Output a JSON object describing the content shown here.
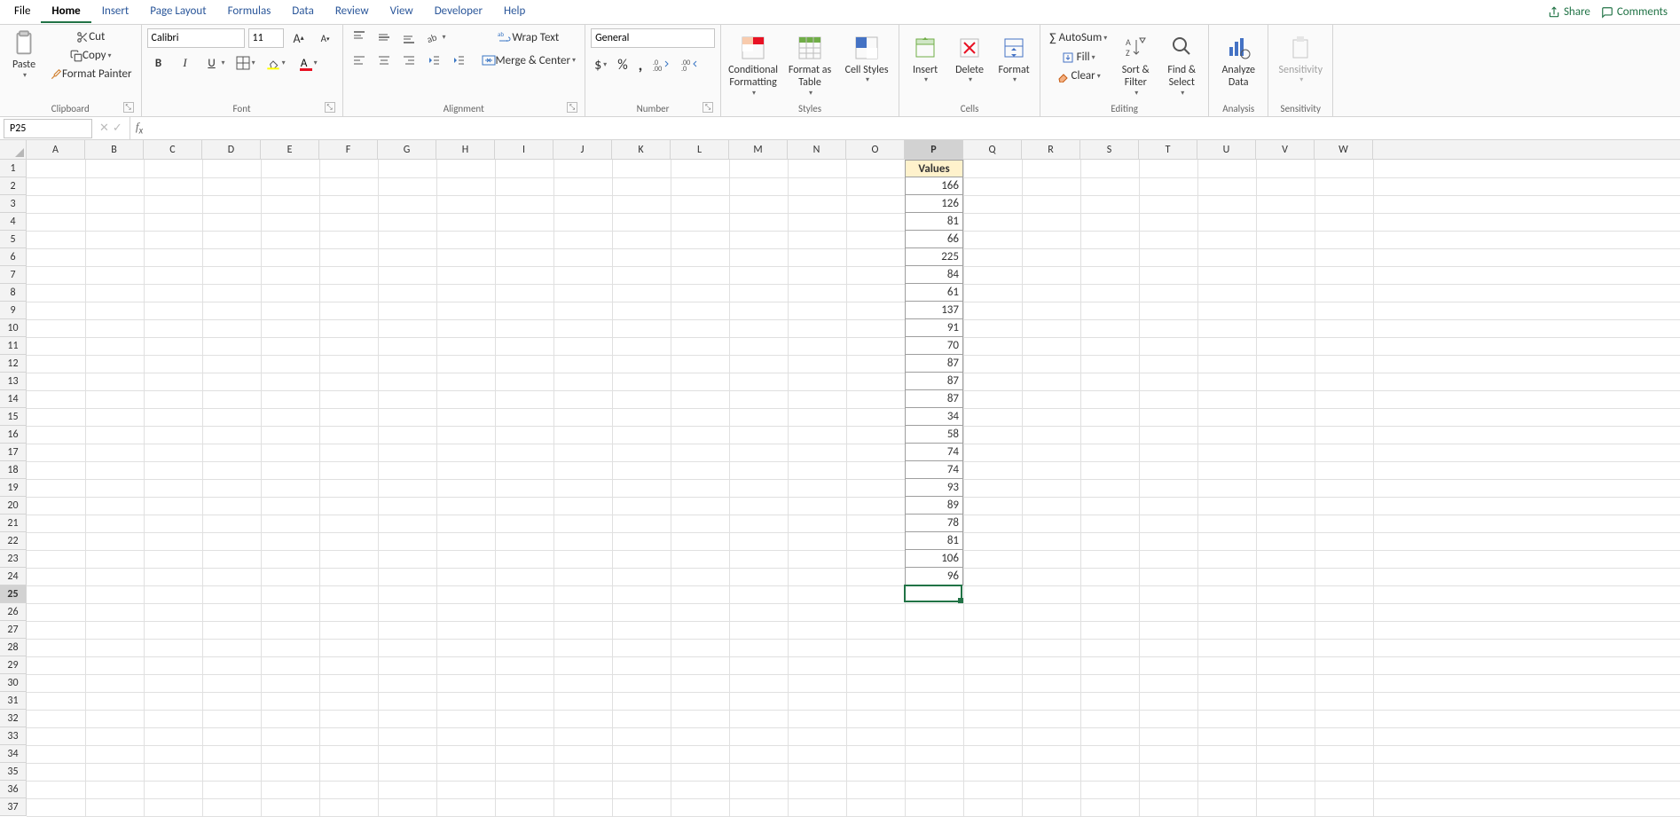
{
  "tabs": {
    "file": "File",
    "home": "Home",
    "insert": "Insert",
    "page_layout": "Page Layout",
    "formulas": "Formulas",
    "data": "Data",
    "review": "Review",
    "view": "View",
    "developer": "Developer",
    "help": "Help"
  },
  "right_actions": {
    "share": "Share",
    "comments": "Comments"
  },
  "ribbon": {
    "clipboard": {
      "paste": "Paste",
      "cut": "Cut",
      "copy": "Copy",
      "format_painter": "Format Painter",
      "label": "Clipboard"
    },
    "font": {
      "name": "Calibri",
      "size": "11",
      "label": "Font"
    },
    "alignment": {
      "wrap": "Wrap Text",
      "merge": "Merge & Center",
      "label": "Alignment"
    },
    "number": {
      "format": "General",
      "label": "Number"
    },
    "styles": {
      "cond": "Conditional Formatting",
      "fat": "Format as Table",
      "cell": "Cell Styles",
      "label": "Styles"
    },
    "cells": {
      "insert": "Insert",
      "delete": "Delete",
      "format": "Format",
      "label": "Cells"
    },
    "editing": {
      "autosum": "AutoSum",
      "fill": "Fill",
      "clear": "Clear",
      "sort": "Sort & Filter",
      "find": "Find & Select",
      "label": "Editing"
    },
    "analysis": {
      "analyze": "Analyze Data",
      "label": "Analysis"
    },
    "sensitivity": {
      "btn": "Sensitivity",
      "label": "Sensitivity"
    }
  },
  "namebox": "P25",
  "formula": "",
  "columns": [
    "A",
    "B",
    "C",
    "D",
    "E",
    "F",
    "G",
    "H",
    "I",
    "J",
    "K",
    "L",
    "M",
    "N",
    "O",
    "P",
    "Q",
    "R",
    "S",
    "T",
    "U",
    "V",
    "W"
  ],
  "row_count": 27,
  "active_cell": {
    "col": 15,
    "row": 24
  },
  "data_column": {
    "col_index": 15,
    "header": "Values",
    "values": [
      166,
      126,
      81,
      66,
      225,
      84,
      61,
      137,
      91,
      70,
      87,
      87,
      87,
      34,
      58,
      74,
      74,
      93,
      89,
      78,
      81,
      106,
      96
    ]
  }
}
